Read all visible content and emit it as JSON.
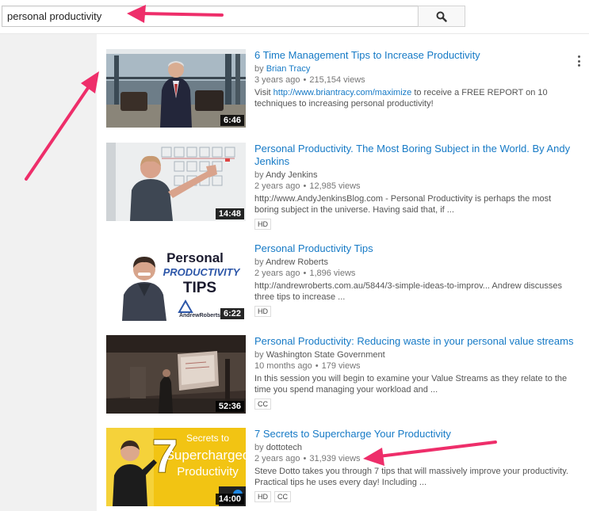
{
  "search": {
    "query": "personal productivity",
    "button_icon": "search-icon"
  },
  "colors": {
    "link": "#167ac6",
    "arrow": "#ee2e6a",
    "sidebar": "#f1f1f1"
  },
  "results": [
    {
      "title": "6 Time Management Tips to Increase Productivity",
      "by": "by",
      "channel": "Brian Tracy",
      "channel_is_link": true,
      "age": "3 years ago",
      "views": "215,154 views",
      "desc_prefix": "Visit ",
      "desc_url": "http://www.briantracy.com/maximize",
      "desc_suffix": " to receive a FREE REPORT on 10 techniques to increasing personal productivity!",
      "duration": "6:46",
      "badges": []
    },
    {
      "title": "Personal Productivity. The Most Boring Subject in the World. By Andy Jenkins",
      "by": "by",
      "channel": "Andy Jenkins",
      "channel_is_link": false,
      "age": "2 years ago",
      "views": "12,985 views",
      "desc_prefix": "http://www.AndyJenkinsBlog.com - Personal Productivity is perhaps the most boring subject in the universe. Having said that, if ...",
      "desc_url": "",
      "desc_suffix": "",
      "duration": "14:48",
      "badges": [
        "HD"
      ]
    },
    {
      "title": "Personal Productivity Tips",
      "by": "by",
      "channel": "Andrew Roberts",
      "channel_is_link": false,
      "age": "2 years ago",
      "views": "1,896 views",
      "desc_prefix": "http://andrewroberts.com.au/5844/3-simple-ideas-to-improv... Andrew discusses three tips to increase ...",
      "desc_url": "",
      "desc_suffix": "",
      "duration": "6:22",
      "badges": [
        "HD"
      ],
      "thumb_text": {
        "line1": "Personal",
        "line2": "PRODUCTIVITY",
        "line3": "TIPS",
        "brand": "AndrewRoberts"
      }
    },
    {
      "title": "Personal Productivity: Reducing waste in your personal value streams",
      "by": "by",
      "channel": "Washington State Government",
      "channel_is_link": false,
      "age": "10 months ago",
      "views": "179 views",
      "desc_prefix": "In this session you will begin to examine your Value Streams as they relate to the time you spend managing your workload and ...",
      "desc_url": "",
      "desc_suffix": "",
      "duration": "52:36",
      "badges": [
        "CC"
      ]
    },
    {
      "title": "7 Secrets to Supercharge Your Productivity",
      "by": "by",
      "channel": "dottotech",
      "channel_is_link": false,
      "age": "2 years ago",
      "views": "31,939 views",
      "desc_prefix": "Steve Dotto takes you through 7 tips that will massively improve your productivity. Practical tips he uses every day! Including ...",
      "desc_url": "",
      "desc_suffix": "",
      "duration": "14:00",
      "badges": [
        "HD",
        "CC"
      ],
      "thumb_text": {
        "number": "7",
        "line1": "Secrets to",
        "line2": "Supercharged",
        "line3": "Productivity"
      }
    }
  ]
}
